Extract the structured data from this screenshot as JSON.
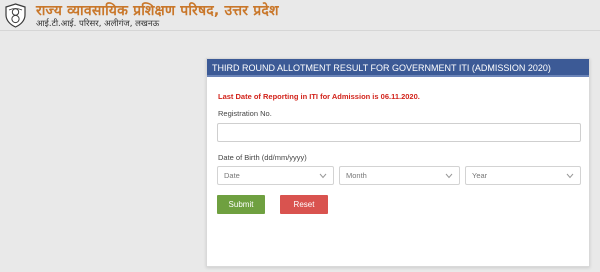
{
  "header": {
    "title": "राज्य व्यावसायिक प्रशिक्षण परिषद, उत्तर प्रदेश",
    "subtitle": "आई.टी.आई. परिसर, अलीगंज, लखनऊ"
  },
  "card": {
    "title": "THIRD ROUND ALLOTMENT RESULT FOR GOVERNMENT ITI (ADMISSION 2020)",
    "notice": "Last Date of Reporting in ITI for Admission is 06.11.2020.",
    "registration_label": "Registration No.",
    "registration_value": "",
    "dob_label": "Date of Birth (dd/mm/yyyy)",
    "date_select": "Date",
    "month_select": "Month",
    "year_select": "Year",
    "submit_label": "Submit",
    "reset_label": "Reset"
  },
  "colors": {
    "header_text": "#c9772a",
    "card_header_bg": "#3c5a96",
    "notice": "#d2231b",
    "submit_bg": "#6fa040",
    "reset_bg": "#d9534f"
  },
  "icons": {
    "logo": "emblem-logo-icon",
    "dropdown": "chevron-down-icon"
  }
}
